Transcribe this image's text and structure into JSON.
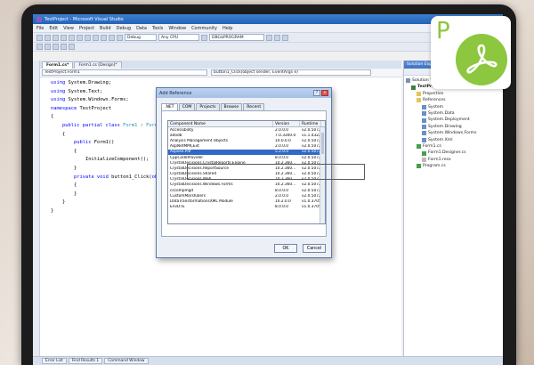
{
  "window": {
    "title": "TestProject - Microsoft Visual Studio"
  },
  "menu": [
    "File",
    "Edit",
    "View",
    "Project",
    "Build",
    "Debug",
    "Data",
    "Tools",
    "Window",
    "Community",
    "Help"
  ],
  "toolbar": {
    "config": "Debug",
    "platform": "Any CPU",
    "search": "DBG$PROGRAM"
  },
  "doc_tabs": [
    "Form1.cs*",
    "Form1.cs [Design]*"
  ],
  "nav": {
    "left": "TestProject.Form1",
    "right": "button1_Click(object sender, EventArgs e)"
  },
  "code_lines": [
    [
      [
        "kw",
        "using"
      ],
      [
        "pl",
        " System.Drawing;"
      ]
    ],
    [
      [
        "kw",
        "using"
      ],
      [
        "pl",
        " System.Text;"
      ]
    ],
    [
      [
        "kw",
        "using"
      ],
      [
        "pl",
        " System.Windows.Forms;"
      ]
    ],
    [
      [
        "pl",
        ""
      ]
    ],
    [
      [
        "kw",
        "namespace"
      ],
      [
        "pl",
        " TestProject"
      ]
    ],
    [
      [
        "pl",
        "{"
      ]
    ],
    [
      [
        "pl",
        "    "
      ],
      [
        "kw",
        "public partial class"
      ],
      [
        "pl",
        " "
      ],
      [
        "ty",
        "Form1"
      ],
      [
        "pl",
        " : "
      ],
      [
        "ty",
        "Form"
      ]
    ],
    [
      [
        "pl",
        "    {"
      ]
    ],
    [
      [
        "pl",
        "        "
      ],
      [
        "kw",
        "public"
      ],
      [
        "pl",
        " Form1()"
      ]
    ],
    [
      [
        "pl",
        "        {"
      ]
    ],
    [
      [
        "pl",
        "            InitializeComponent();"
      ]
    ],
    [
      [
        "pl",
        "        }"
      ]
    ],
    [
      [
        "pl",
        ""
      ]
    ],
    [
      [
        "pl",
        "        "
      ],
      [
        "kw",
        "private void"
      ],
      [
        "pl",
        " button1_Click("
      ],
      [
        "kw",
        "object"
      ],
      [
        "pl",
        " se"
      ]
    ],
    [
      [
        "pl",
        "        {"
      ]
    ],
    [
      [
        "pl",
        ""
      ]
    ],
    [
      [
        "pl",
        "        }"
      ]
    ],
    [
      [
        "pl",
        "    }"
      ]
    ],
    [
      [
        "pl",
        "}"
      ]
    ]
  ],
  "solution_explorer": {
    "title": "Solution Explorer - TestProject",
    "items": [
      {
        "label": "Solution 'TestProject' (1 project)",
        "icon": "solution-icon",
        "indent": 0
      },
      {
        "label": "TestProject",
        "icon": "project-icon",
        "indent": 1,
        "bold": true
      },
      {
        "label": "Properties",
        "icon": "folder-icon",
        "indent": 2
      },
      {
        "label": "References",
        "icon": "folder-icon",
        "indent": 2
      },
      {
        "label": "System",
        "icon": "reference-icon",
        "indent": 3
      },
      {
        "label": "System.Data",
        "icon": "reference-icon",
        "indent": 3
      },
      {
        "label": "System.Deployment",
        "icon": "reference-icon",
        "indent": 3
      },
      {
        "label": "System.Drawing",
        "icon": "reference-icon",
        "indent": 3
      },
      {
        "label": "System.Windows.Forms",
        "icon": "reference-icon",
        "indent": 3
      },
      {
        "label": "System.Xml",
        "icon": "reference-icon",
        "indent": 3
      },
      {
        "label": "Form1.cs",
        "icon": "cs-file-icon",
        "indent": 2
      },
      {
        "label": "Form1.Designer.cs",
        "icon": "cs-file-icon",
        "indent": 3
      },
      {
        "label": "Form1.resx",
        "icon": "resx-icon",
        "indent": 3
      },
      {
        "label": "Program.cs",
        "icon": "cs-file-icon",
        "indent": 2
      }
    ]
  },
  "bottom_tabs": [
    "Error List",
    "Find Results 1",
    "Command Window"
  ],
  "dialog": {
    "title": "Add Reference",
    "tabs": [
      ".NET",
      "COM",
      "Projects",
      "Browse",
      "Recent"
    ],
    "active_tab": ".NET",
    "columns": [
      "Component Name",
      "Version",
      "Runtime"
    ],
    "rows": [
      {
        "name": "Accessibility",
        "version": "2.0.0.0",
        "runtime": "v2.0.5072"
      },
      {
        "name": "adodb",
        "version": "7.0.3300.0",
        "runtime": "v1.1.4322"
      },
      {
        "name": "Analysis Management Objects",
        "version": "10.0.0.0",
        "runtime": "v2.0.5072"
      },
      {
        "name": "AspNetMMCExt",
        "version": "2.0.0.0",
        "runtime": "v2.0.5072"
      },
      {
        "name": "Aspose.Pdf",
        "version": "5.2.0.0",
        "runtime": "v2.0.5072",
        "selected": true
      },
      {
        "name": "CppCodeProvider",
        "version": "8.0.0.0",
        "runtime": "v2.0.5072"
      },
      {
        "name": "CrystalDecisions.CrystalReports.Engine",
        "version": "10.2.360...",
        "runtime": "v2.0.5072"
      },
      {
        "name": "CrystalDecisions.ReportSource",
        "version": "10.2.360...",
        "runtime": "v2.0.5072"
      },
      {
        "name": "CrystalDecisions.Shared",
        "version": "10.2.360...",
        "runtime": "v2.0.5072"
      },
      {
        "name": "CrystalDecisions.Web",
        "version": "10.2.360...",
        "runtime": "v2.0.5072"
      },
      {
        "name": "CrystalDecisions.Windows.Forms",
        "version": "10.2.360...",
        "runtime": "v2.0.5072"
      },
      {
        "name": "cscompmgd",
        "version": "8.0.0.0",
        "runtime": "v2.0.5072"
      },
      {
        "name": "CustomMarshalers",
        "version": "2.0.0.0",
        "runtime": "v2.0.5072"
      },
      {
        "name": "DataTransformationsXML Module",
        "version": "10.2.0.0",
        "runtime": "v1.0.3705"
      },
      {
        "name": "EnvDTE",
        "version": "8.0.0.0",
        "runtime": "v1.0.3705"
      }
    ],
    "ok_label": "OK",
    "cancel_label": "Cancel",
    "close_glyph": "×",
    "help_glyph": "?"
  },
  "badge": {
    "letter": "P",
    "icon": "acrobat-pdf-icon",
    "color": "#8dc63f"
  }
}
